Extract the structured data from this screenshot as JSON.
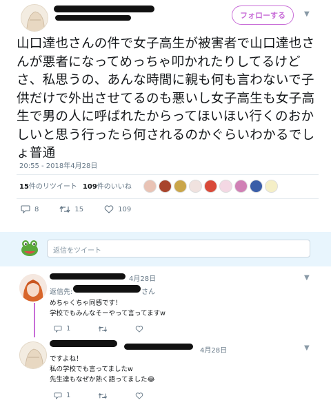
{
  "tweet": {
    "follow_label": "フォローする",
    "text": "山口達也さんの件で女子高生が被害者で山口達也さんが悪者になってめっちゃ叩かれたりしてるけどさ、私思うの、あんな時間に親も何も言わないで子供だけで外出させてるのも悪いし女子高生も女子高生で男の人に呼ばれたからってほいほい行くのおかしいと思う行ったら何されるのかぐらいわかるでしょ普通",
    "timestamp": "20:55 - 2018年4月28日",
    "retweet_count": "15",
    "retweet_label": "件のリツイート",
    "like_count": "109",
    "like_label": "件のいいね",
    "actions": {
      "reply": "8",
      "retweet": "15",
      "like": "109"
    }
  },
  "composer": {
    "placeholder": "返信をツイート"
  },
  "replies": [
    {
      "date": "4月28日",
      "reply_to_prefix": "返信先:",
      "reply_to_suffix": "さん",
      "lines": [
        "めちゃくちゃ同感です！",
        "学校でもみんなそーやって言ってますw"
      ],
      "actions": {
        "reply": "1",
        "retweet": "",
        "like": ""
      }
    },
    {
      "date": "4月28日",
      "lines": [
        "ですよね！",
        "私の学校でも言ってましたw",
        "先生達もなぜか熱く語ってました😂"
      ],
      "actions": {
        "reply": "1",
        "retweet": "",
        "like": ""
      }
    }
  ],
  "colors": {
    "accent": "#c86dd7",
    "text": "#14171a",
    "muted": "#657786",
    "composer_bg": "#e8f5fd"
  },
  "icons": [
    "reply-icon",
    "retweet-icon",
    "like-icon",
    "chevron-down-icon",
    "frog-avatar-icon"
  ]
}
